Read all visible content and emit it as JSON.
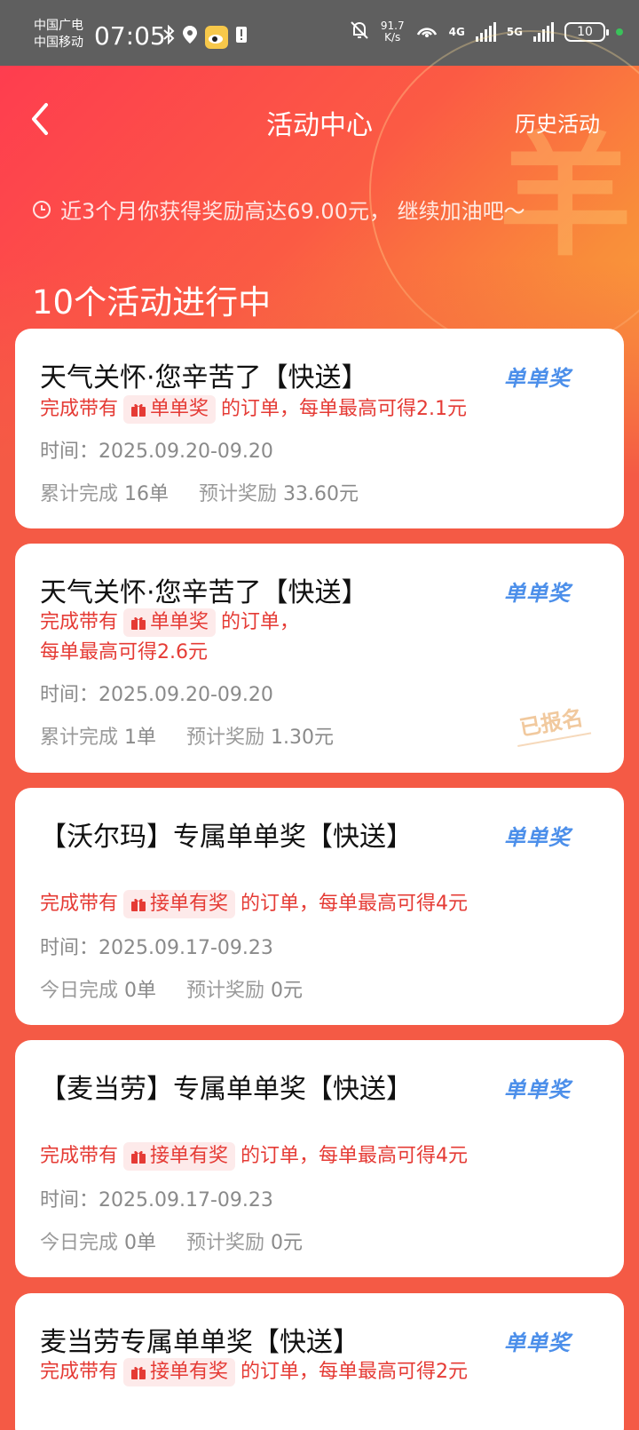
{
  "status_bar": {
    "carrier_1": "中国广电",
    "carrier_2": "中国移动",
    "time": "07:05",
    "speed_value": "91.7",
    "speed_unit": "K/s",
    "sim1_network": "4G",
    "sim2_network": "5G",
    "battery": "10"
  },
  "header": {
    "title": "活动中心",
    "history_link": "历史活动",
    "summary": "近3个月你获得奖励高达69.00元， 继续加油吧～",
    "active_count": "10个活动进行中",
    "deco_char": "羊"
  },
  "activities": [
    {
      "title": "天气关怀·您辛苦了【快送】",
      "tag": "单单奖",
      "desc_prefix": "完成带有",
      "badge": "单单奖",
      "desc_suffix": "的订单，每单最高可得2.1元",
      "time_label": "时间：2025.09.20-09.20",
      "stat1_label": "累计完成",
      "stat1_value": "16单",
      "stat2_label": "预计奖励",
      "stat2_value": "33.60元"
    },
    {
      "title": "天气关怀·您辛苦了【快送】",
      "tag": "单单奖",
      "desc_prefix": "完成带有",
      "badge": "单单奖",
      "desc_suffix": "的订单，",
      "desc_line2": "每单最高可得2.6元",
      "time_label": "时间：2025.09.20-09.20",
      "stat1_label": "累计完成",
      "stat1_value": "1单",
      "stat2_label": "预计奖励",
      "stat2_value": "1.30元",
      "stamp": "已报名"
    },
    {
      "title": "【沃尔玛】专属单单奖【快送】",
      "tag": "单单奖",
      "desc_prefix": "完成带有",
      "badge": "接单有奖",
      "desc_suffix": "的订单，每单最高可得4元",
      "time_label": "时间：2025.09.17-09.23",
      "stat1_label": "今日完成",
      "stat1_value": "0单",
      "stat2_label": "预计奖励",
      "stat2_value": "0元"
    },
    {
      "title": "【麦当劳】专属单单奖【快送】",
      "tag": "单单奖",
      "desc_prefix": "完成带有",
      "badge": "接单有奖",
      "desc_suffix": "的订单，每单最高可得4元",
      "time_label": "时间：2025.09.17-09.23",
      "stat1_label": "今日完成",
      "stat1_value": "0单",
      "stat2_label": "预计奖励",
      "stat2_value": "0元"
    },
    {
      "title": "麦当劳专属单单奖【快送】",
      "tag": "单单奖",
      "desc_prefix": "完成带有",
      "badge": "接单有奖",
      "desc_suffix": "的订单，每单最高可得2元"
    }
  ]
}
